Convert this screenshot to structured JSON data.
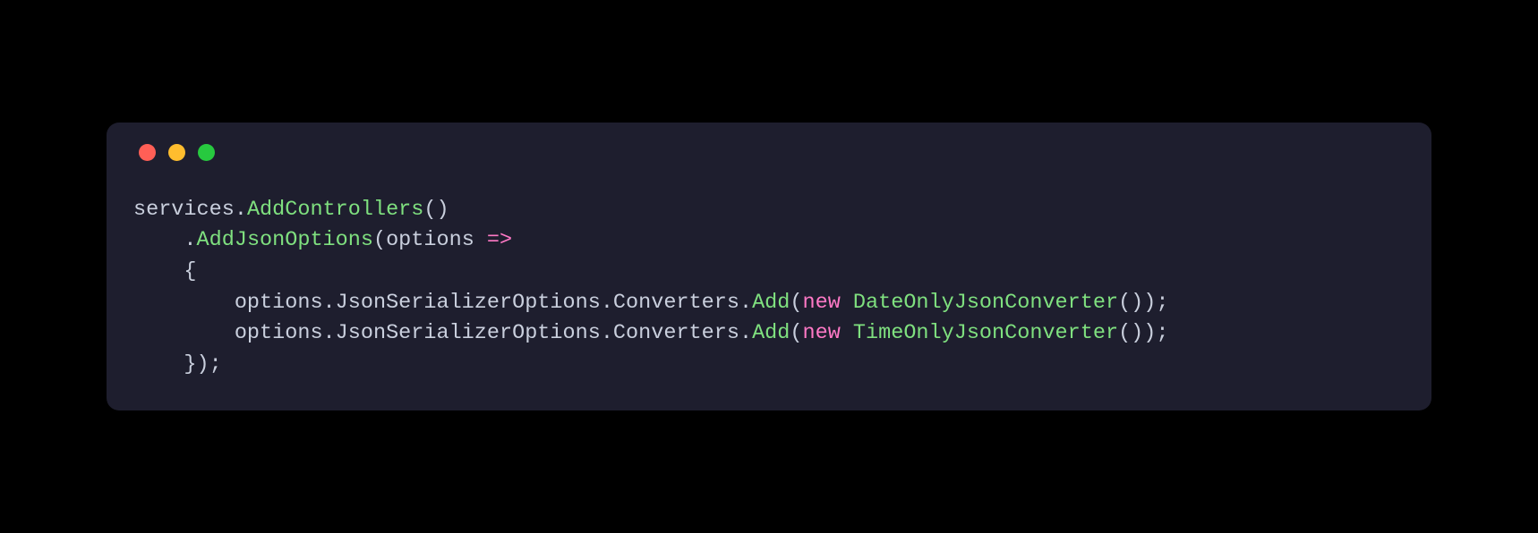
{
  "code": {
    "line1": {
      "ident": "services",
      "dot": ".",
      "call": "AddControllers",
      "parens": "()"
    },
    "line2": {
      "indent": "    ",
      "dot": ".",
      "call": "AddJsonOptions",
      "lparen": "(",
      "param": "options",
      "space": " ",
      "arrow": "=>"
    },
    "line3": {
      "indent": "    ",
      "brace": "{"
    },
    "line4": {
      "indent": "        ",
      "var": "options",
      "dot1": ".",
      "prop1": "JsonSerializerOptions",
      "dot2": ".",
      "prop2": "Converters",
      "dot3": ".",
      "call": "Add",
      "lparen": "(",
      "kw": "new",
      "space": " ",
      "type": "DateOnlyJsonConverter",
      "ctorParens": "()",
      "rparen": ")",
      "semi": ";"
    },
    "line5": {
      "indent": "        ",
      "var": "options",
      "dot1": ".",
      "prop1": "JsonSerializerOptions",
      "dot2": ".",
      "prop2": "Converters",
      "dot3": ".",
      "call": "Add",
      "lparen": "(",
      "kw": "new",
      "space": " ",
      "type": "TimeOnlyJsonConverter",
      "ctorParens": "()",
      "rparen": ")",
      "semi": ";"
    },
    "line6": {
      "indent": "    ",
      "brace": "}",
      "rparen": ")",
      "semi": ";"
    }
  }
}
